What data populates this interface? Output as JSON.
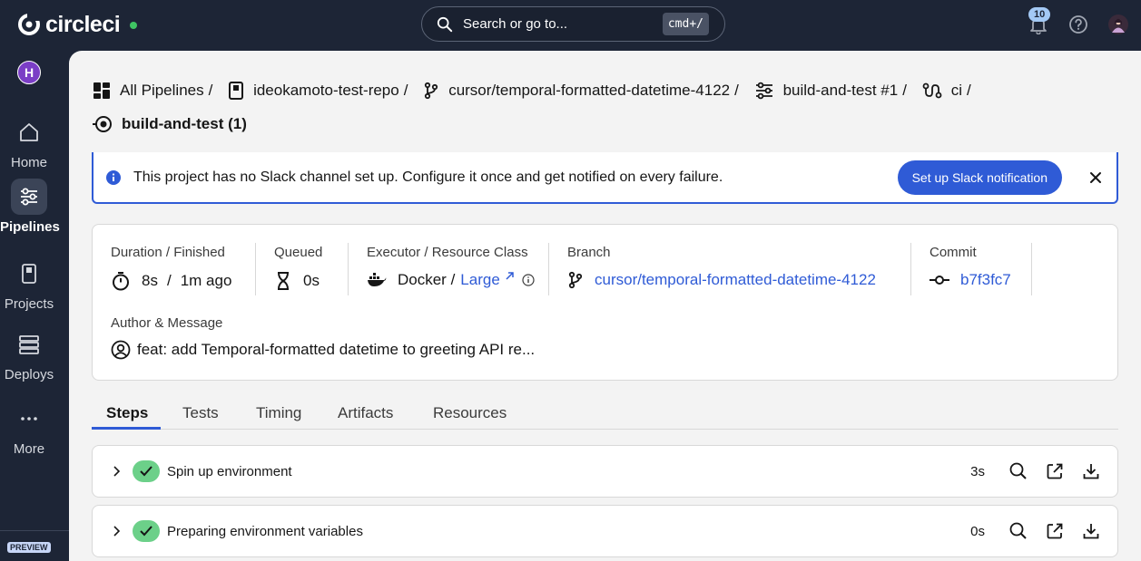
{
  "app": {
    "logo_text": "circleci"
  },
  "search": {
    "placeholder": "Search or go to...",
    "shortcut": "cmd+/"
  },
  "header": {
    "notifications_count": "10"
  },
  "org": {
    "initial": "H"
  },
  "sidebar": {
    "items": [
      {
        "label": "Home",
        "icon": "home-icon"
      },
      {
        "label": "Pipelines",
        "icon": "pipelines-icon",
        "active": true
      },
      {
        "label": "Projects",
        "icon": "projects-icon"
      },
      {
        "label": "Deploys",
        "icon": "deploys-icon"
      },
      {
        "label": "More",
        "icon": "more-icon"
      }
    ],
    "preview_badge": "PREVIEW"
  },
  "breadcrumb": {
    "all_pipelines": "All Pipelines",
    "repo": "ideokamoto-test-repo",
    "branch": "cursor/temporal-formatted-datetime-4122",
    "pipeline": "build-and-test #1",
    "workflow": "ci",
    "job": "build-and-test (1)",
    "separator": "/"
  },
  "banner": {
    "text": "This project has no Slack channel set up. Configure it once and get notified on every failure.",
    "button_label": "Set up Slack notification"
  },
  "job_info": {
    "duration_label": "Duration / Finished",
    "duration": "8s",
    "finished": "1m ago",
    "queued_label": "Queued",
    "queued": "0s",
    "executor_label": "Executor / Resource Class",
    "executor": "Docker /",
    "resource_class": "Large",
    "branch_label": "Branch",
    "branch": "cursor/temporal-formatted-datetime-4122",
    "commit_label": "Commit",
    "commit": "b7f3fc7",
    "author_label": "Author & Message",
    "message": "feat: add Temporal-formatted datetime to greeting API re..."
  },
  "tabs": [
    "Steps",
    "Tests",
    "Timing",
    "Artifacts",
    "Resources"
  ],
  "steps": [
    {
      "name": "Spin up environment",
      "duration": "3s",
      "status": "success"
    },
    {
      "name": "Preparing environment variables",
      "duration": "0s",
      "status": "success"
    }
  ],
  "colors": {
    "accent": "#2f5bd6",
    "success": "#6cd089",
    "nav_bg": "#1d2536"
  }
}
